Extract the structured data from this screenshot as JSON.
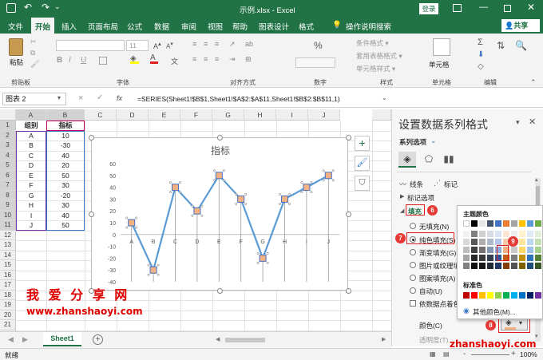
{
  "titlebar": {
    "title": "示例.xlsx  -  Excel",
    "login": "登录"
  },
  "menu": {
    "items": [
      "文件",
      "开始",
      "插入",
      "页面布局",
      "公式",
      "数据",
      "审阅",
      "视图",
      "帮助",
      "图表设计",
      "格式"
    ],
    "tell": "操作说明搜索",
    "share": "共享"
  },
  "ribbon": {
    "paste": "粘贴",
    "font_size": "11",
    "bold": "B",
    "italic": "I",
    "underline": "U",
    "wen": "文",
    "wrap": "ab",
    "percent": "%",
    "styles": [
      "条件格式 ▾",
      "套用表格格式 ▾",
      "单元格样式 ▾"
    ],
    "cell_label": "单元格",
    "edit_label": "编辑",
    "groups": [
      "剪贴板",
      "字体",
      "对齐方式",
      "数字",
      "样式",
      "单元格",
      "编辑"
    ]
  },
  "formula": {
    "namebox": "图表 2",
    "cancel": "×",
    "confirm": "✓",
    "fx": "fx",
    "text": "=SERIES(Sheet1!$B$1,Sheet1!$A$2:$A$11,Sheet1!$B$2:$B$11,1)"
  },
  "grid": {
    "cols": [
      "A",
      "B",
      "C",
      "D",
      "E",
      "F",
      "G",
      "H",
      "I",
      "J"
    ],
    "rows": [
      "1",
      "2",
      "3",
      "4",
      "5",
      "6",
      "7",
      "8",
      "9",
      "10",
      "11",
      "12",
      "13",
      "14",
      "15",
      "16",
      "17",
      "18",
      "19",
      "20",
      "21",
      "22",
      "23"
    ],
    "header": [
      "组别",
      "指标"
    ],
    "labels": [
      "A",
      "B",
      "C",
      "D",
      "E",
      "F",
      "G",
      "H",
      "I",
      "J"
    ],
    "values": [
      "10",
      "-30",
      "40",
      "20",
      "50",
      "30",
      "-20",
      "30",
      "40",
      "50"
    ]
  },
  "chart_data": {
    "type": "line",
    "title": "指标",
    "categories": [
      "A",
      "B",
      "C",
      "D",
      "E",
      "F",
      "G",
      "H",
      "I",
      "J"
    ],
    "series": [
      {
        "name": "",
        "values": [
          10,
          -30,
          40,
          20,
          50,
          30,
          -20,
          30,
          40,
          50
        ]
      }
    ],
    "ylim": [
      -40,
      60
    ],
    "yticks": [
      "60",
      "50",
      "40",
      "30",
      "20",
      "10",
      "0",
      "-10",
      "-20",
      "-30",
      "-40"
    ],
    "grid": false,
    "drop_lines": true
  },
  "watermark": {
    "text1": "我 爱 分 享 网",
    "text2": "www.zhanshaoyi.com",
    "text3": "zhanshaoyi.com"
  },
  "pane": {
    "title": "设置数据系列格式",
    "subtitle": "系列选项",
    "line": "线条",
    "marker": "标记",
    "marker_opts": "标记选项",
    "fill": "填充",
    "opts": [
      "无填充(N)",
      "纯色填充(S)",
      "渐变填充(G)",
      "图片或纹理填",
      "图案填充(A)",
      "自动(U)"
    ],
    "vary": "依数据点着色",
    "color_label": "颜色(C)",
    "transparency": "透明度(T)"
  },
  "palette": {
    "theme": "主题颜色",
    "standard": "标准色",
    "more": "其他颜色(M)..."
  },
  "badges": [
    "6",
    "7",
    "8",
    "9"
  ],
  "sheet": {
    "tab": "Sheet1",
    "add": "+"
  },
  "status": {
    "left": "就绪",
    "zoom": "100%",
    "minus": "-",
    "plus": "+"
  },
  "colors": {
    "accent": "#217346",
    "series": "#5b9bd5",
    "marker_fill": "#f4b183",
    "marker_border": "#4472c4",
    "red": "#e02020"
  }
}
